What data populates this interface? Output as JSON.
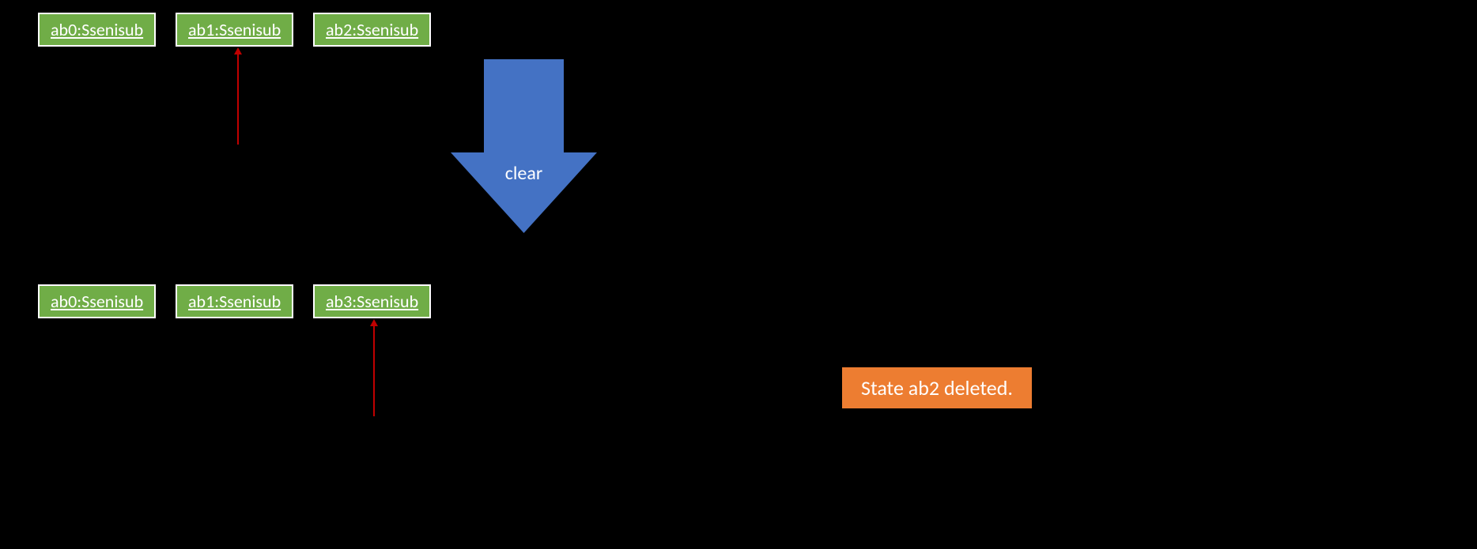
{
  "rows": {
    "top": [
      {
        "label": "ab0:Ssenisub"
      },
      {
        "label": "ab1:Ssenisub"
      },
      {
        "label": "ab2:Ssenisub"
      }
    ],
    "bottom": [
      {
        "label": "ab0:Ssenisub"
      },
      {
        "label": "ab1:Ssenisub"
      },
      {
        "label": "ab3:Ssenisub"
      }
    ]
  },
  "action": {
    "label": "clear"
  },
  "status": {
    "message": "State ab2 deleted."
  },
  "colors": {
    "box_fill": "#70AD47",
    "box_border": "#FFFFFF",
    "arrow_small": "#C00000",
    "arrow_big": "#4472C4",
    "status_fill": "#ED7D31",
    "background": "#000000"
  }
}
